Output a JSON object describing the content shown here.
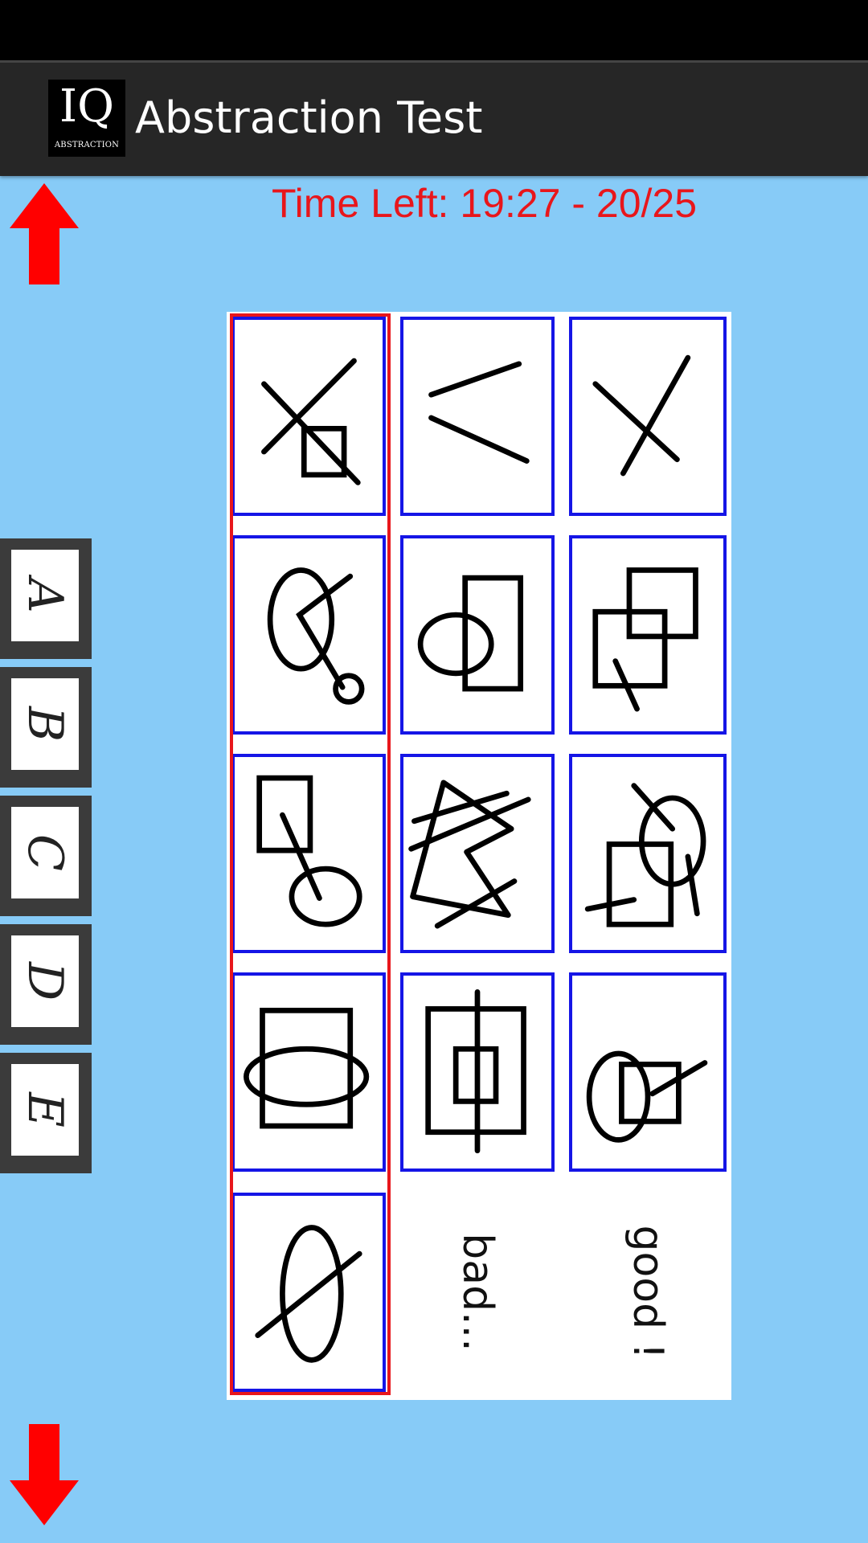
{
  "app": {
    "icon_text": "IQ",
    "icon_subtext": "ABSTRACTION",
    "title": "Abstraction Test"
  },
  "timer": {
    "text": "Time Left: 19:27 - 20/25"
  },
  "navigation": {
    "up_icon": "arrow-up-icon",
    "down_icon": "arrow-down-icon",
    "arrow_color": "#ff0000"
  },
  "answers": [
    {
      "label": "A"
    },
    {
      "label": "B"
    },
    {
      "label": "C"
    },
    {
      "label": "D"
    },
    {
      "label": "E"
    }
  ],
  "puzzle": {
    "verdict_bad": "bad...",
    "verdict_good": "good !",
    "border_color": "#1515e6",
    "highlight_color": "#e8161b"
  },
  "colors": {
    "background": "#87cbf7",
    "status_bar": "#000000",
    "action_bar": "#262626",
    "timer": "#e8161b"
  }
}
